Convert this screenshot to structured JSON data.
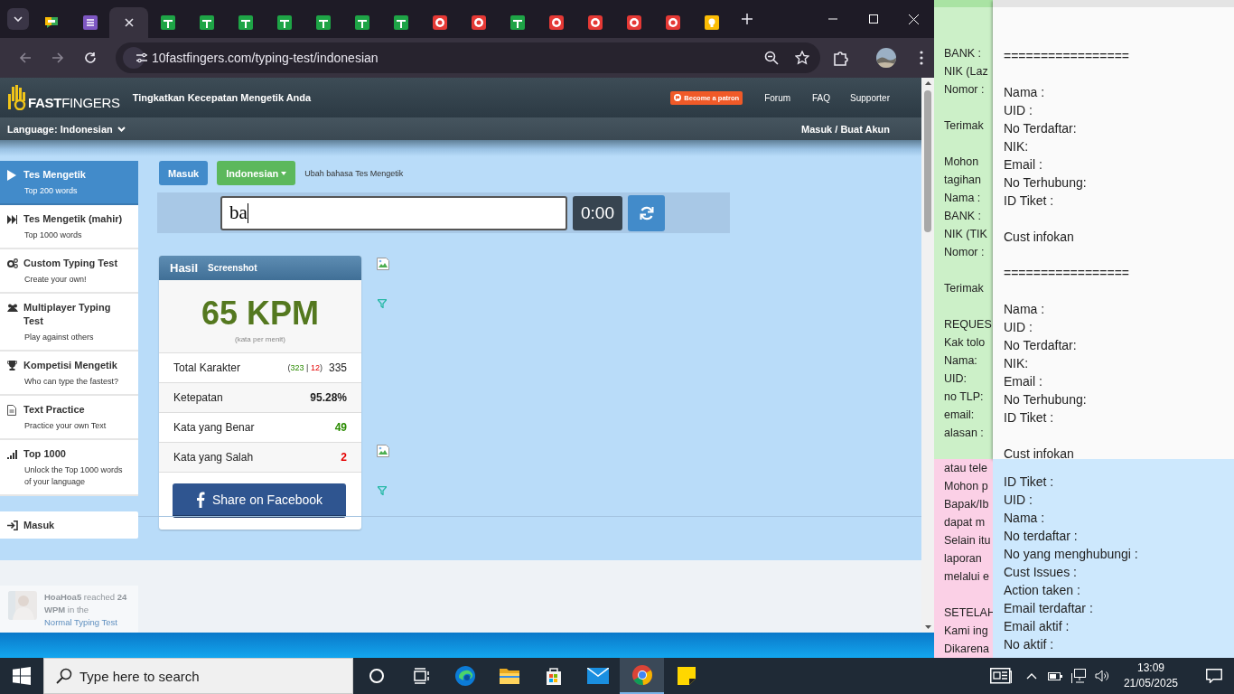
{
  "browser": {
    "tabs": [
      {
        "kind": "chat",
        "selected": false
      },
      {
        "kind": "list",
        "selected": false
      },
      {
        "kind": "blank",
        "selected": true
      },
      {
        "kind": "sheet",
        "selected": false
      },
      {
        "kind": "sheet",
        "selected": false
      },
      {
        "kind": "sheet",
        "selected": false
      },
      {
        "kind": "sheet",
        "selected": false
      },
      {
        "kind": "sheet",
        "selected": false
      },
      {
        "kind": "sheet",
        "selected": false
      },
      {
        "kind": "sheet",
        "selected": false
      },
      {
        "kind": "ring",
        "selected": false
      },
      {
        "kind": "ring",
        "selected": false
      },
      {
        "kind": "sheet",
        "selected": false
      },
      {
        "kind": "ring",
        "selected": false
      },
      {
        "kind": "ring",
        "selected": false
      },
      {
        "kind": "ring",
        "selected": false
      },
      {
        "kind": "ring",
        "selected": false
      },
      {
        "kind": "bulb",
        "selected": false
      }
    ],
    "url": "10fastfingers.com/typing-test/indonesian"
  },
  "site": {
    "logo": "**FAST**FINGERS",
    "tagline": "Tingkatkan Kecepatan Mengetik Anda",
    "patron_button": "Become a patron",
    "nav": [
      "Forum",
      "FAQ",
      "Supporter"
    ],
    "language": "Language: Indonesian",
    "account_link": "Masuk / Buat Akun"
  },
  "sidebar": {
    "items": [
      {
        "kind": "play",
        "title": "Tes Mengetik",
        "subtitle": "Top 200 words",
        "selected": true
      },
      {
        "kind": "forward",
        "title": "Tes Mengetik (mahir)",
        "subtitle": "Top 1000 words",
        "selected": false
      },
      {
        "kind": "gears",
        "title": "Custom Typing Test",
        "subtitle": "Create your own!",
        "selected": false
      },
      {
        "kind": "users",
        "title": "Multiplayer Typing Test",
        "subtitle": "Play against others",
        "selected": false
      },
      {
        "kind": "trophy",
        "title": "Kompetisi Mengetik",
        "subtitle": "Who can type the fastest?",
        "selected": false
      },
      {
        "kind": "file",
        "title": "Text Practice",
        "subtitle": "Practice your own Text",
        "selected": false
      },
      {
        "kind": "bars",
        "title": "Top 1000",
        "subtitle": "Unlock the Top 1000 words of your language",
        "selected": false
      }
    ],
    "login": "Masuk"
  },
  "test": {
    "login_button": "Masuk",
    "language_button": "Indonesian",
    "change_language": "Ubah bahasa Tes Mengetik",
    "input": "ba",
    "timer": "0:00"
  },
  "result": {
    "title": "Hasil",
    "screenshot": "Screenshot",
    "speed": "65 KPM",
    "speed_caption": "(kata per menit)",
    "rows": [
      {
        "kind": "chars",
        "label": "Total Karakter",
        "open": "(",
        "correct": "323",
        "separator": "|",
        "wrong": "12",
        "close": ")",
        "value": "335"
      },
      {
        "kind": "plain",
        "label": "Ketepatan",
        "value": "95.28%"
      },
      {
        "kind": "good",
        "label": "Kata yang Benar",
        "value": "49"
      },
      {
        "kind": "bad",
        "label": "Kata yang Salah",
        "value": "2"
      }
    ],
    "share": "Share on Facebook"
  },
  "notification": {
    "text": "**HoaHoa5** reached **24 WPM** in the",
    "link": "Normal Typing Test"
  },
  "notes": {
    "green": [
      {
        "lines": [
          "BANK :",
          "NIK (Laz",
          "Nomor :"
        ]
      },
      {
        "lines": [
          "Terimak"
        ]
      },
      {
        "lines": [
          "Mohon",
          "tagihan",
          "Nama :",
          "BANK :",
          "NIK (TIK",
          "Nomor :"
        ]
      },
      {
        "lines": [
          "Terimak"
        ]
      },
      {
        "lines": [
          "REQUES",
          "Kak tolo",
          "Nama:",
          "UID:",
          "no TLP:",
          "email:",
          "alasan :"
        ]
      }
    ],
    "pink": [
      {
        "lines": [
          "atau tele",
          "Mohon p",
          "Bapak/Ib",
          "dapat m",
          "Selain itu",
          "laporan",
          "melalui e"
        ]
      },
      {
        "lines": [
          "SETELAH",
          "Kami ing",
          "Dikarena"
        ]
      }
    ],
    "white": [
      {
        "lines": [
          "================="
        ]
      },
      {
        "lines": [
          "Nama :",
          "UID :",
          "No Terdaftar:",
          "NIK:",
          "Email :",
          "No Terhubung:",
          "ID Tiket :"
        ]
      },
      {
        "lines": [
          "Cust infokan"
        ]
      },
      {
        "lines": [
          "================="
        ]
      },
      {
        "lines": [
          "Nama :",
          "UID :",
          "No Terdaftar:",
          "NIK:",
          "Email :",
          "No Terhubung:",
          "ID Tiket :"
        ]
      },
      {
        "lines": [
          "Cust infokan"
        ]
      }
    ],
    "blue": [
      {
        "lines": [
          "ID Tiket :",
          "UID :",
          "Nama :",
          "No terdaftar :",
          "No yang menghubungi :",
          "Cust Issues :",
          "Action taken :",
          "Email terdaftar :",
          "Email aktif :",
          "No aktif :"
        ]
      }
    ]
  },
  "taskbar": {
    "search_placeholder": "Type here to search",
    "apps": [
      {
        "kind": "cortana",
        "selected": false
      },
      {
        "kind": "taskview",
        "selected": false
      },
      {
        "kind": "edge",
        "selected": false
      },
      {
        "kind": "folder",
        "selected": false
      },
      {
        "kind": "store",
        "selected": false
      },
      {
        "kind": "mail",
        "selected": false
      },
      {
        "kind": "chrome",
        "selected": true
      },
      {
        "kind": "sticky",
        "selected": false
      }
    ],
    "time": "13:09",
    "date": "21/05/2025"
  }
}
